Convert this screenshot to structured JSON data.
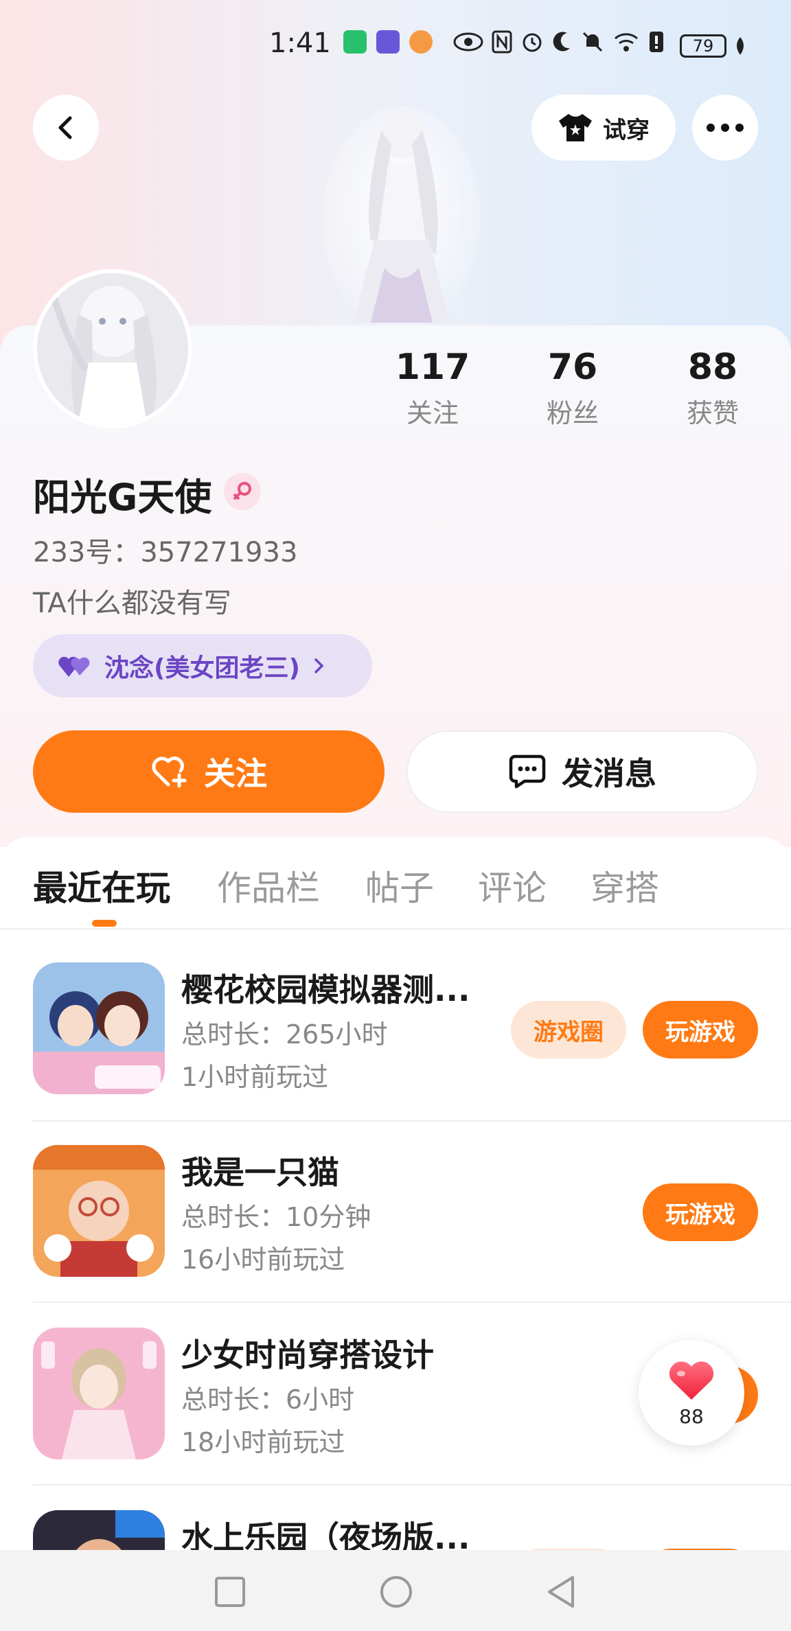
{
  "status_bar": {
    "time": "1:41",
    "battery": "79"
  },
  "header": {
    "tryon_label": "试穿"
  },
  "profile": {
    "name": "阳光G天使",
    "uid": "233号：357271933",
    "bio": "TA什么都没有写",
    "relation": "沈念(美女团老三)",
    "stats": [
      {
        "value": "117",
        "label": "关注"
      },
      {
        "value": "76",
        "label": "粉丝"
      },
      {
        "value": "88",
        "label": "获赞"
      }
    ]
  },
  "actions": {
    "follow_label": "关注",
    "message_label": "发消息"
  },
  "tabs": [
    "最近在玩",
    "作品栏",
    "帖子",
    "评论",
    "穿搭"
  ],
  "games": [
    {
      "title": "樱花校园模拟器测...",
      "duration": "总时长：265小时",
      "last_played": "1小时前玩过",
      "circle_label": "游戏圈",
      "play_label": "玩游戏"
    },
    {
      "title": "我是一只猫",
      "duration": "总时长：10分钟",
      "last_played": "16小时前玩过",
      "play_label": "玩游戏"
    },
    {
      "title": "少女时尚穿搭设计",
      "duration": "总时长：6小时",
      "last_played": "18小时前玩过"
    },
    {
      "title": "水上乐园（夜场版..."
    }
  ],
  "like_bubble": {
    "count": "88"
  },
  "colors": {
    "accent": "#ff7a14",
    "relation_text": "#6b45c4"
  }
}
